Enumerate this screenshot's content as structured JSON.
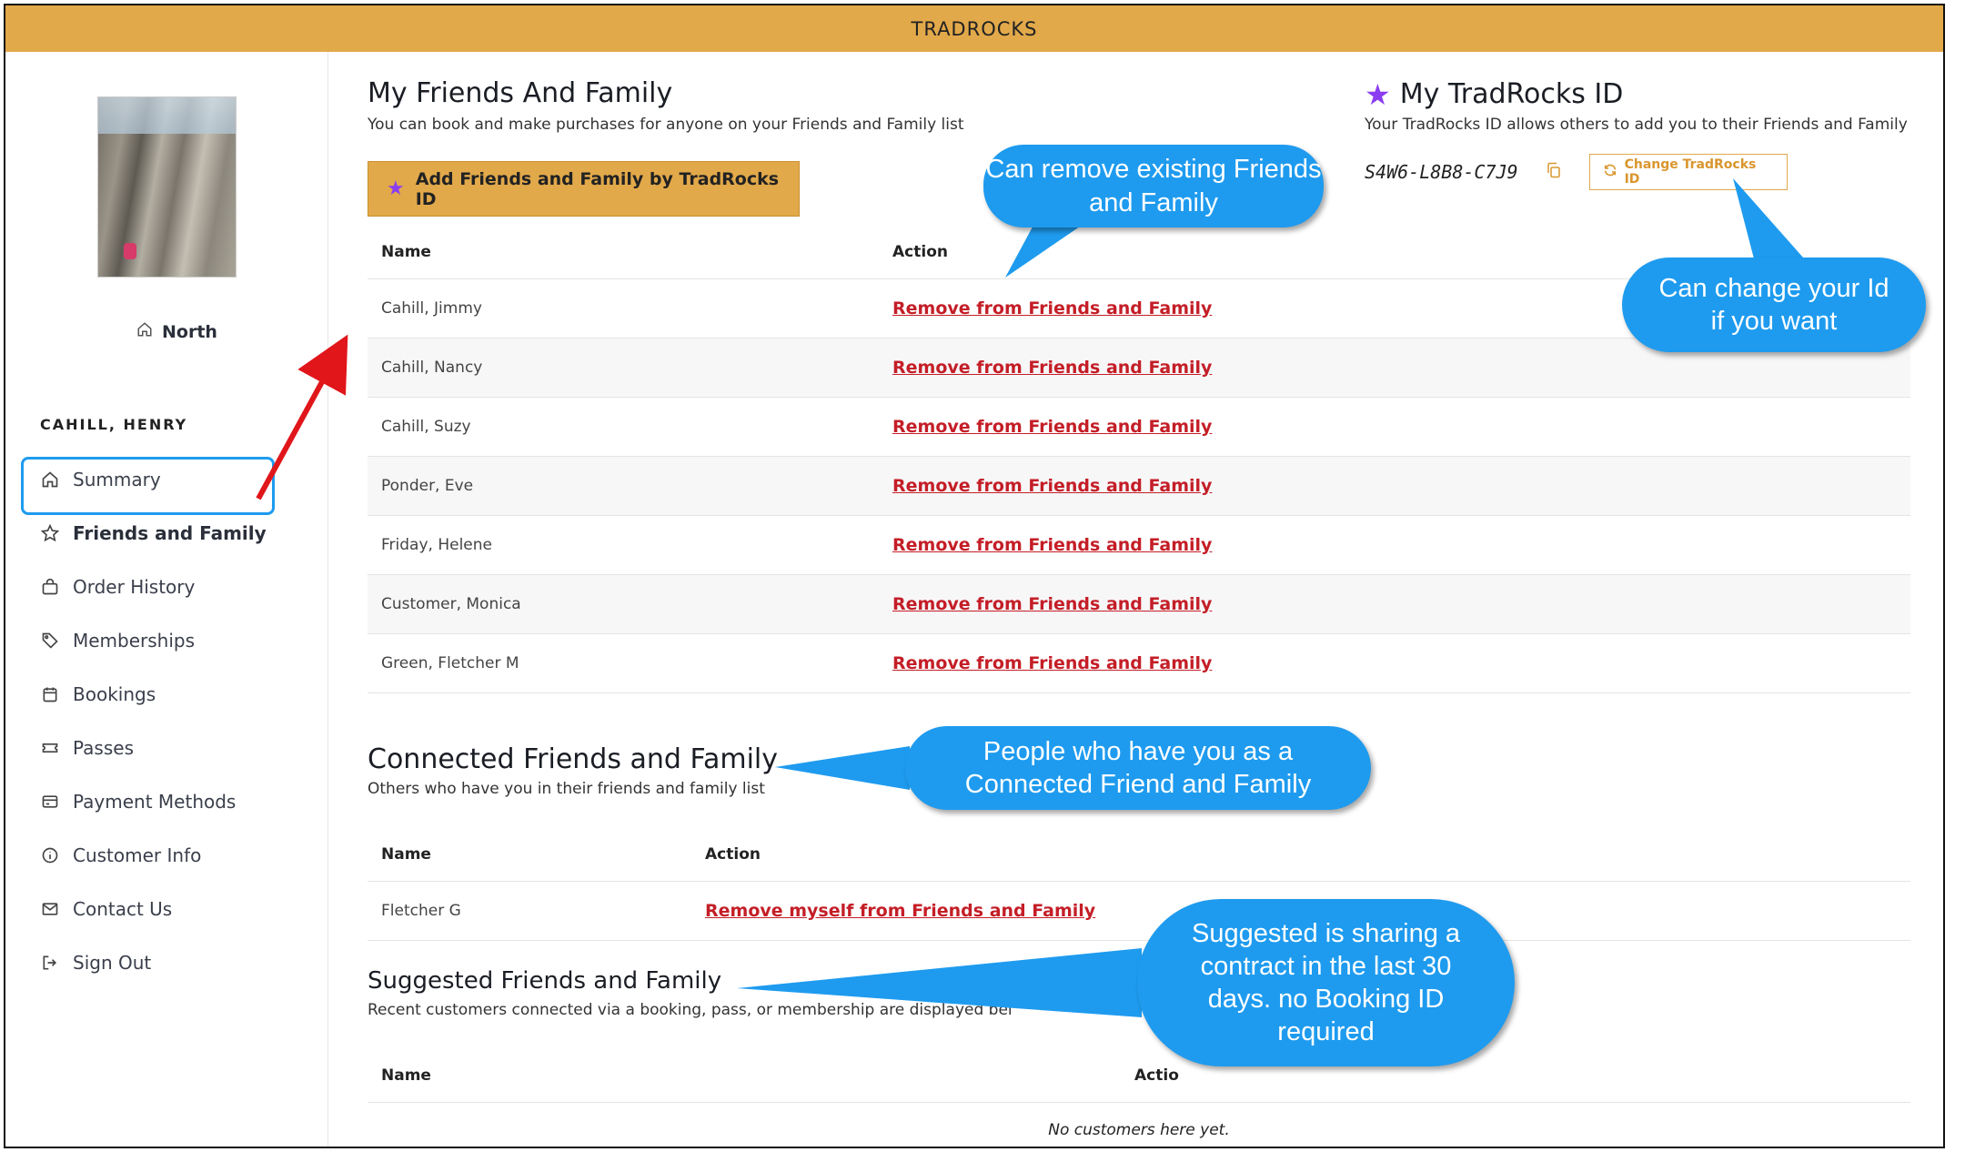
{
  "app": {
    "title": "TRADROCKS"
  },
  "sidebar": {
    "location": "North",
    "username": "CAHILL, HENRY",
    "items": [
      {
        "label": "Summary",
        "icon": "home-icon"
      },
      {
        "label": "Friends and Family",
        "icon": "star-icon",
        "active": true
      },
      {
        "label": "Order History",
        "icon": "bag-icon"
      },
      {
        "label": "Memberships",
        "icon": "tag-icon"
      },
      {
        "label": "Bookings",
        "icon": "calendar-icon"
      },
      {
        "label": "Passes",
        "icon": "ticket-icon"
      },
      {
        "label": "Payment Methods",
        "icon": "card-icon"
      },
      {
        "label": "Customer Info",
        "icon": "info-icon"
      },
      {
        "label": "Contact Us",
        "icon": "mail-icon"
      },
      {
        "label": "Sign Out",
        "icon": "sign-out-icon"
      }
    ]
  },
  "friends": {
    "title": "My Friends And Family",
    "subtitle": "You can book and make purchases for anyone on your Friends and Family list",
    "add_button": "Add Friends and Family by TradRocks ID",
    "headers": {
      "name": "Name",
      "action": "Action"
    },
    "action_label": "Remove from Friends and Family",
    "rows": [
      {
        "name": "Cahill, Jimmy"
      },
      {
        "name": "Cahill, Nancy"
      },
      {
        "name": "Cahill, Suzy"
      },
      {
        "name": "Ponder, Eve"
      },
      {
        "name": "Friday, Helene"
      },
      {
        "name": "Customer, Monica"
      },
      {
        "name": "Green, Fletcher M"
      }
    ]
  },
  "tradrocks_id": {
    "title": "My TradRocks ID",
    "description": "Your TradRocks ID allows others to add you to their Friends and Family",
    "code": "S4W6-L8B8-C7J9",
    "change_button": "Change TradRocks ID"
  },
  "connected": {
    "title": "Connected Friends and Family",
    "subtitle": "Others who have you in their friends and family list",
    "headers": {
      "name": "Name",
      "action": "Action"
    },
    "rows": [
      {
        "name": "Fletcher G",
        "action": "Remove myself from Friends and Family"
      }
    ]
  },
  "suggested": {
    "title": "Suggested Friends and Family",
    "subtitle": "Recent customers connected via a booking, pass, or membership are displayed bel",
    "headers": {
      "name": "Name",
      "action": "Actio"
    },
    "empty": "No customers here yet."
  },
  "callouts": {
    "remove": "Can remove existing Friends and Family",
    "change_id": "Can change your Id if you want",
    "connected": "People who have you as a Connected Friend and Family",
    "suggested": "Suggested is sharing a contract in the last 30 days. no Booking ID required"
  },
  "colors": {
    "accent": "#e2a94a",
    "link": "#c41e27",
    "callout": "#1e9bef",
    "arrow": "#e0161b",
    "star": "#8a3ef0"
  }
}
